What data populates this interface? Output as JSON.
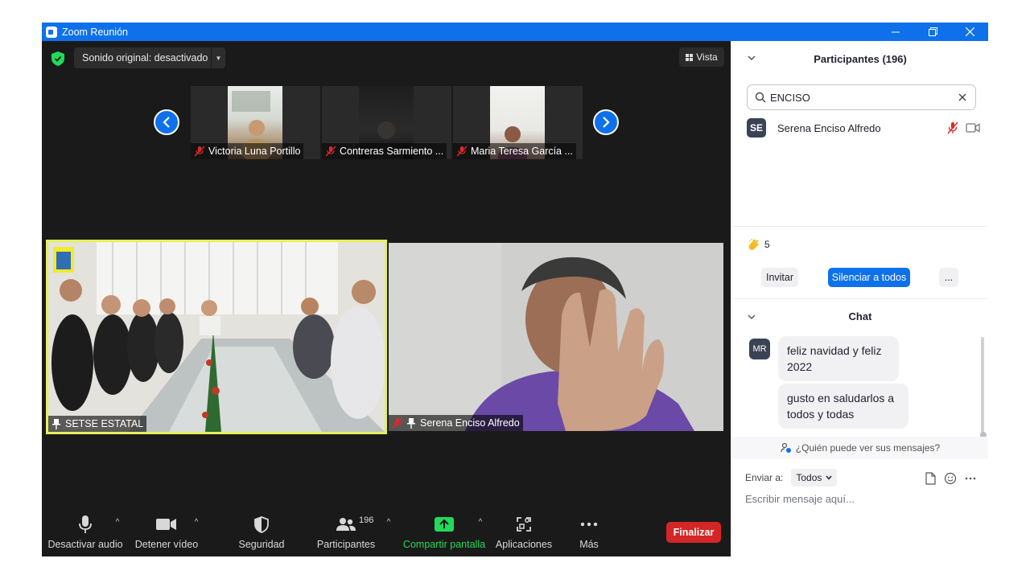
{
  "window": {
    "title": "Zoom Reunión",
    "controls": [
      "minimize",
      "restore",
      "close"
    ]
  },
  "meeting": {
    "sound_label": "Sonido original: desactivado",
    "view_label": "Vista",
    "thumbnails": [
      {
        "name": "Victoria Luna Portillo"
      },
      {
        "name": "Contreras Sarmiento ..."
      },
      {
        "name": "Maria Teresa García ..."
      }
    ],
    "videos": [
      {
        "name": "SETSE ESTATAL"
      },
      {
        "name": "Serena Enciso Alfredo"
      }
    ]
  },
  "toolbar": {
    "audio_label": "Desactivar audio",
    "video_label": "Detener vídeo",
    "security_label": "Seguridad",
    "participants_label": "Participantes",
    "participants_count": "196",
    "share_label": "Compartir pantalla",
    "apps_label": "Aplicaciones",
    "more_label": "Más",
    "end_label": "Finalizar",
    "colors": {
      "share": "#23d959",
      "end": "#d42626"
    }
  },
  "participants_panel": {
    "title": "Participantes (196)",
    "search_value": "ENCISO",
    "results": [
      {
        "initials": "SE",
        "name": "Serena Enciso Alfredo"
      }
    ],
    "reactions_count": "5",
    "invite_label": "Invitar",
    "mute_all_label": "Silenciar a todos",
    "more_label": "..."
  },
  "chat": {
    "title": "Chat",
    "sender_initials": "MR",
    "messages": [
      "feliz navidad y feliz 2022",
      "gusto en saludarlos a todos y todas"
    ],
    "who_can_see": "¿Quién puede ver sus mensajes?",
    "send_to_label": "Enviar a:",
    "send_to_value": "Todos",
    "input_placeholder": "Escribir mensaje aquí...",
    "accent_color": "#0e71eb"
  }
}
